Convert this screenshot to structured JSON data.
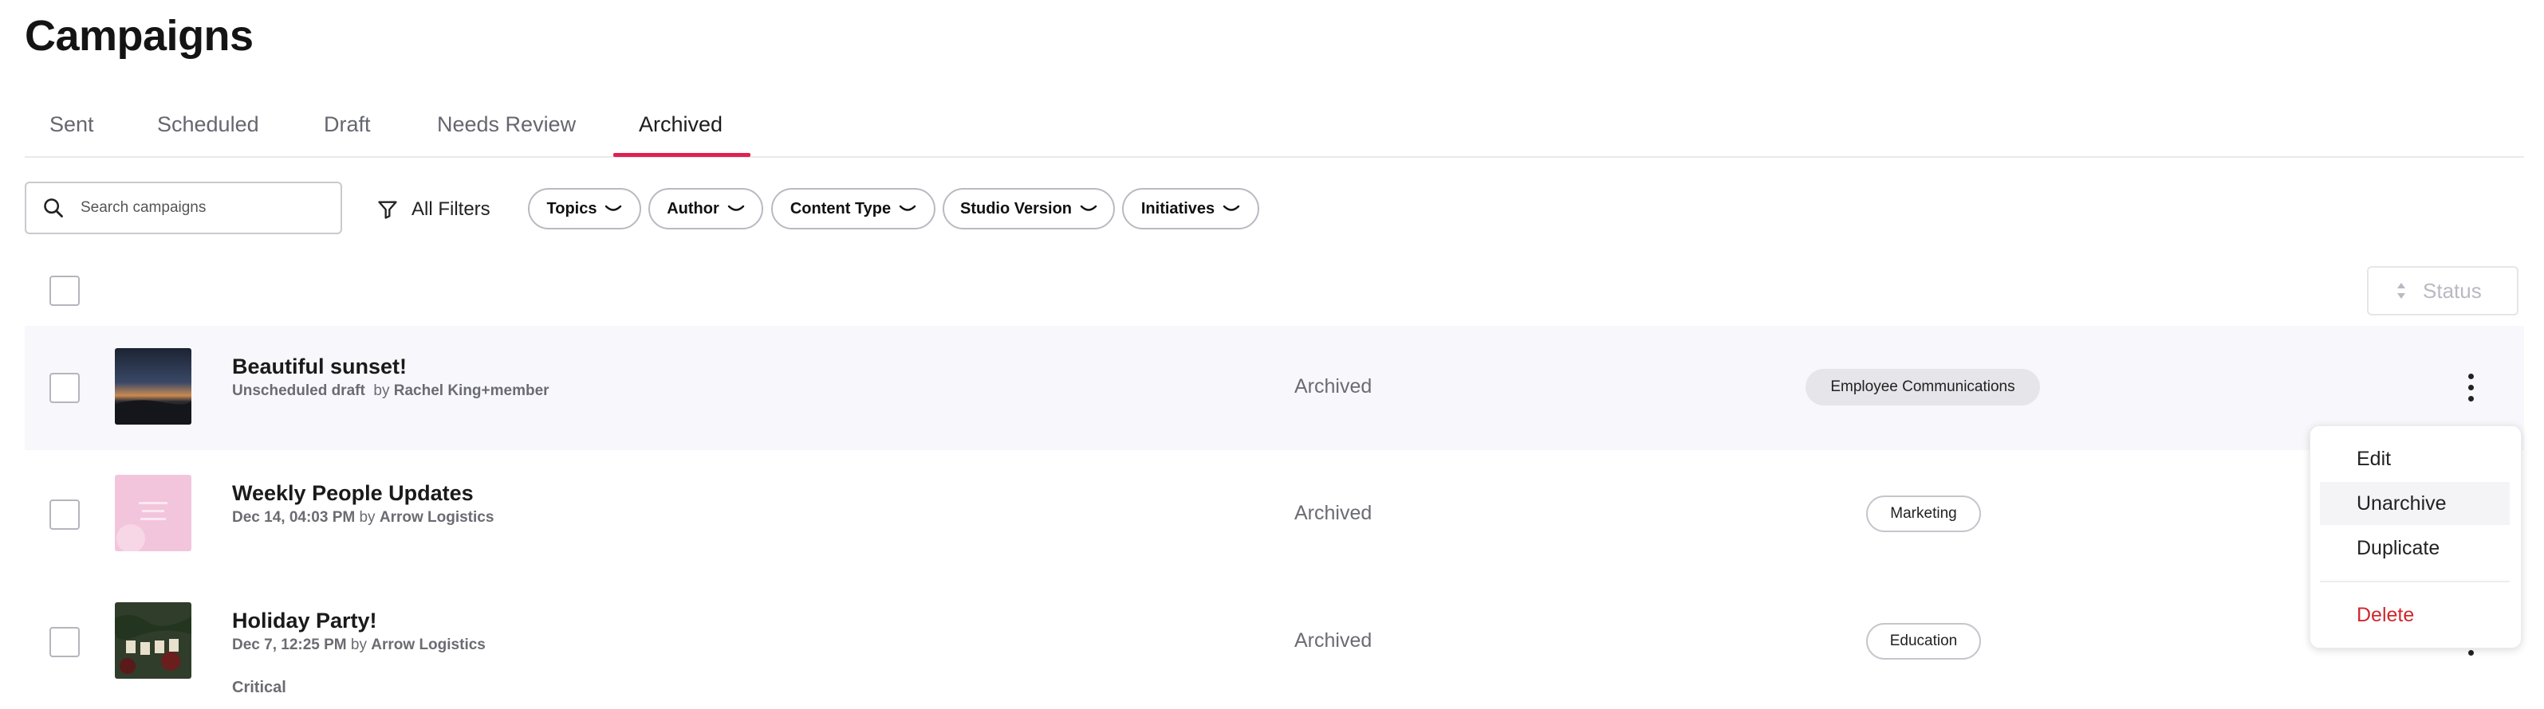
{
  "page": {
    "title": "Campaigns"
  },
  "tabs": [
    {
      "label": "Sent"
    },
    {
      "label": "Scheduled"
    },
    {
      "label": "Draft"
    },
    {
      "label": "Needs Review"
    },
    {
      "label": "Archived",
      "active": true
    }
  ],
  "search": {
    "placeholder": "Search campaigns",
    "value": ""
  },
  "filters": {
    "all_label": "All Filters",
    "chips": [
      {
        "label": "Topics"
      },
      {
        "label": "Author"
      },
      {
        "label": "Content Type"
      },
      {
        "label": "Studio Version"
      },
      {
        "label": "Initiatives"
      }
    ]
  },
  "sort": {
    "label": "Status"
  },
  "rows": [
    {
      "title": "Beautiful sunset!",
      "meta_date": "Unscheduled draft",
      "meta_by": "by",
      "meta_author": "Rachel King+member",
      "extra": "",
      "status": "Archived",
      "tag": "Employee Communications",
      "highlighted": true
    },
    {
      "title": "Weekly People Updates",
      "meta_date": "Dec 14, 04:03 PM",
      "meta_by": "by",
      "meta_author": "Arrow Logistics",
      "extra": "",
      "status": "Archived",
      "tag": "Marketing"
    },
    {
      "title": "Holiday Party!",
      "meta_date": "Dec 7, 12:25 PM",
      "meta_by": "by",
      "meta_author": "Arrow Logistics",
      "extra": "Critical",
      "status": "Archived",
      "tag": "Education"
    }
  ],
  "menu": {
    "items": [
      {
        "label": "Edit"
      },
      {
        "label": "Unarchive"
      },
      {
        "label": "Duplicate"
      },
      {
        "label": "Delete"
      }
    ]
  },
  "colors": {
    "accent": "#e02050",
    "danger": "#d0272c",
    "row_highlight": "#f8f8fc",
    "tag_fill": "#e5e5ea"
  }
}
